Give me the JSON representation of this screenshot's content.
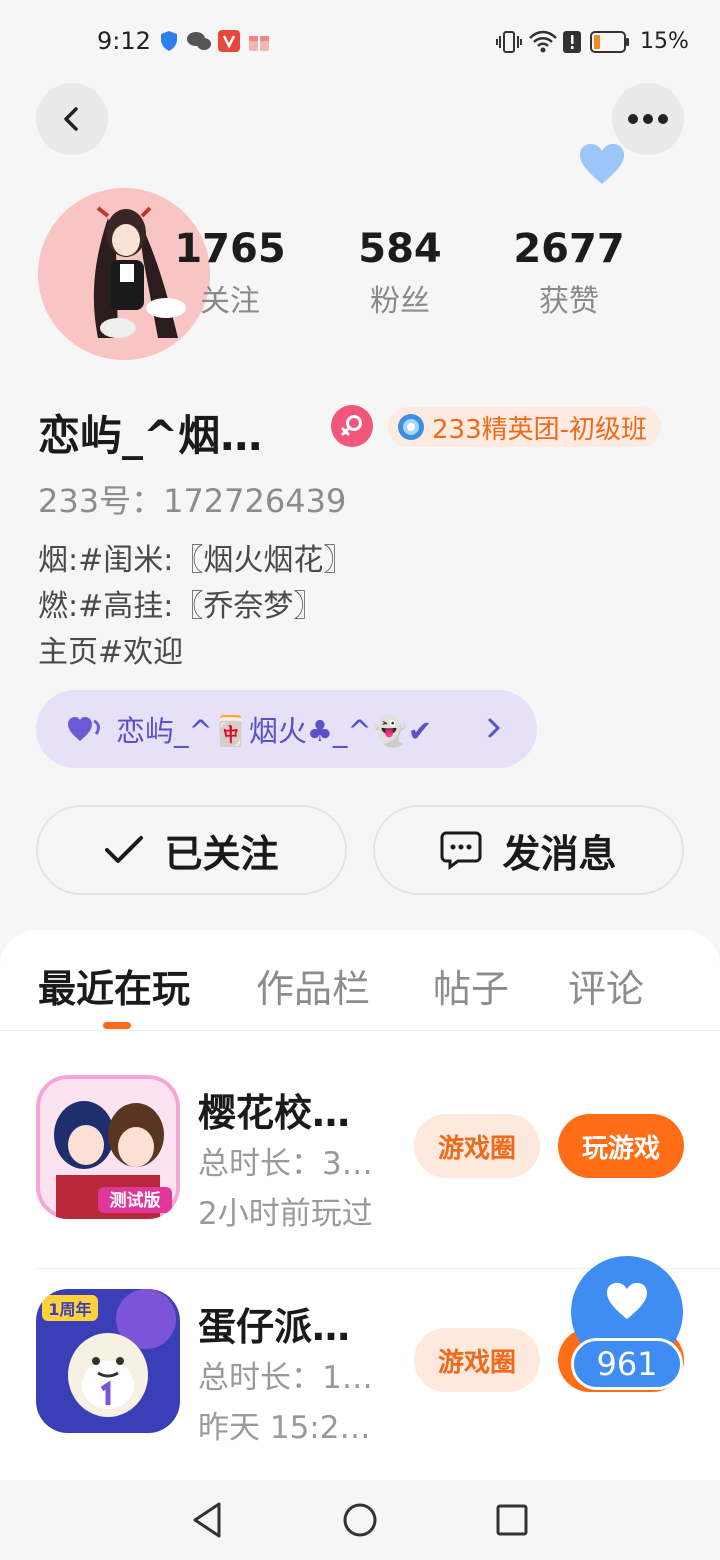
{
  "status_bar": {
    "time": "9:12",
    "battery": "15%",
    "icons": [
      "shield-icon",
      "wechat-icon",
      "app-v-icon",
      "gift-icon",
      "vibrate-icon",
      "wifi-icon",
      "alert-icon",
      "battery-icon"
    ]
  },
  "profile": {
    "stats": [
      {
        "value": "1765",
        "label": "关注"
      },
      {
        "value": "584",
        "label": "粉丝"
      },
      {
        "value": "2677",
        "label": "获赞"
      }
    ],
    "username": "恋屿_^烟…",
    "rank_badge": "233精英团-初级班",
    "user_id": "233号：172726439",
    "bio_lines": [
      "烟:#闺米:〖烟火烟花〗",
      "燃:#高挂:〖乔奈梦〗",
      "主页#欢迎"
    ],
    "fan_pill": "恋屿_^🀄烟火♣_^👻✔"
  },
  "actions": {
    "follow": "已关注",
    "message": "发消息"
  },
  "tabs": [
    "最近在玩",
    "作品栏",
    "帖子",
    "评论"
  ],
  "games": [
    {
      "title": "樱花校…",
      "duration": "总时长：3…",
      "last_played": "2小时前玩过",
      "icon_badge": "测试版",
      "circle_button": "游戏圈",
      "play_button": "玩游戏"
    },
    {
      "title": "蛋仔派…",
      "duration": "总时长：1…",
      "last_played": "昨天 15:2…",
      "icon_badge": "1周年",
      "circle_button": "游戏圈",
      "play_button": "玩游戏"
    }
  ],
  "float_like": {
    "count": "961"
  },
  "colors": {
    "accent": "#ff6e17",
    "like_blue": "#3f8cf3",
    "rank_orange": "#ee6a1d",
    "pill_purple": "#5b50c6"
  }
}
